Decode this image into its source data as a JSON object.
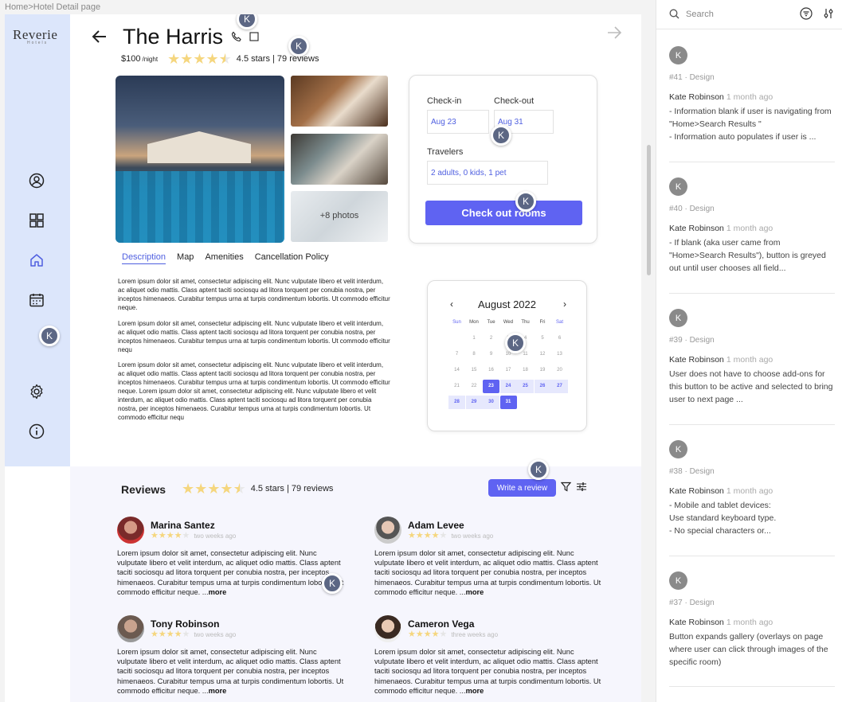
{
  "breadcrumb": "Home>Hotel Detail page",
  "brand": {
    "name": "Reverie",
    "sub": "Hotels"
  },
  "nav": {
    "items": [
      {
        "name": "profile",
        "icon": "user-circle-icon"
      },
      {
        "name": "dashboard",
        "icon": "grid-icon"
      },
      {
        "name": "home",
        "icon": "home-icon"
      },
      {
        "name": "calendar",
        "icon": "calendar-icon"
      },
      {
        "name": "settings",
        "icon": "gear-icon"
      },
      {
        "name": "info",
        "icon": "info-icon"
      }
    ],
    "active": "home"
  },
  "hotel": {
    "name": "The Harris",
    "price": "$100",
    "price_unit": "/night",
    "rating": 4.5,
    "rating_text": "4.5 stars | 79 reviews"
  },
  "gallery": {
    "more_label": "+8 photos"
  },
  "booking": {
    "checkin_label": "Check-in",
    "checkin_value": "Aug 23",
    "checkout_label": "Check-out",
    "checkout_value": "Aug 31",
    "travelers_label": "Travelers",
    "travelers_value": "2 adults, 0 kids, 1 pet",
    "button_label": "Check out rooms"
  },
  "tabs": [
    {
      "label": "Description",
      "active": true
    },
    {
      "label": "Map",
      "active": false
    },
    {
      "label": "Amenities",
      "active": false
    },
    {
      "label": "Cancellation Policy",
      "active": false
    }
  ],
  "description": [
    "Lorem ipsum dolor sit amet, consectetur adipiscing elit. Nunc vulputate libero et velit interdum, ac aliquet odio mattis. Class aptent taciti sociosqu ad litora torquent per conubia nostra, per inceptos himenaeos. Curabitur tempus urna at turpis condimentum lobortis. Ut commodo efficitur neque.",
    "Lorem ipsum dolor sit amet, consectetur adipiscing elit. Nunc vulputate libero et velit interdum, ac aliquet odio mattis. Class aptent taciti sociosqu ad litora torquent per conubia nostra, per inceptos himenaeos. Curabitur tempus urna at turpis condimentum lobortis. Ut commodo efficitur nequ",
    "Lorem ipsum dolor sit amet, consectetur adipiscing elit. Nunc vulputate libero et velit interdum, ac aliquet odio mattis. Class aptent taciti sociosqu ad litora torquent per conubia nostra, per inceptos himenaeos. Curabitur tempus urna at turpis condimentum lobortis. Ut commodo efficitur neque. Lorem ipsum dolor sit amet, consectetur adipiscing elit. Nunc vulputate libero et velit interdum, ac aliquet odio mattis. Class aptent taciti sociosqu ad litora torquent per conubia nostra, per inceptos himenaeos. Curabitur tempus urna at turpis condimentum lobortis. Ut commodo efficitur nequ"
  ],
  "calendar": {
    "title": "August 2022",
    "prev": "‹",
    "next": "›",
    "weekdays": [
      "Sun",
      "Mon",
      "Tue",
      "Wed",
      "Thu",
      "Fri",
      "Sat"
    ],
    "weeks": [
      [
        "",
        "1",
        "2",
        "3",
        "4",
        "5",
        "6"
      ],
      [
        "7",
        "8",
        "9",
        "10",
        "11",
        "12",
        "13"
      ],
      [
        "14",
        "15",
        "16",
        "17",
        "18",
        "19",
        "20"
      ],
      [
        "21",
        "22",
        "23",
        "24",
        "25",
        "26",
        "27"
      ],
      [
        "28",
        "29",
        "30",
        "31",
        "",
        "",
        ""
      ]
    ],
    "range_start": "23",
    "range_end": "31",
    "range_color": "#5f63f2",
    "range_fill": "#e6e8fd"
  },
  "reviews": {
    "title": "Reviews",
    "rating_text": "4.5 stars | 79 reviews",
    "write_label": "Write a review",
    "items": [
      {
        "name": "Marina Santez",
        "when": "two weeks ago",
        "body": "Lorem ipsum dolor sit amet, consectetur adipiscing elit. Nunc vulputate libero et velit interdum, ac aliquet odio mattis. Class aptent taciti sociosqu ad litora torquent per conubia nostra, per inceptos himenaeos. Curabitur tempus urna at turpis condimentum lobortis. Ut commodo efficitur neque. ...",
        "more": "more"
      },
      {
        "name": "Adam Levee",
        "when": "two weeks ago",
        "body": "Lorem ipsum dolor sit amet, consectetur adipiscing elit. Nunc vulputate libero et velit interdum, ac aliquet odio mattis. Class aptent taciti sociosqu ad litora torquent per conubia nostra, per inceptos himenaeos. Curabitur tempus urna at turpis condimentum lobortis. Ut commodo efficitur neque. ...",
        "more": "more"
      },
      {
        "name": "Tony Robinson",
        "when": "two weeks ago",
        "body": "Lorem ipsum dolor sit amet, consectetur adipiscing elit. Nunc vulputate libero et velit interdum, ac aliquet odio mattis. Class aptent taciti sociosqu ad litora torquent per conubia nostra, per inceptos himenaeos. Curabitur tempus urna at turpis condimentum lobortis. Ut commodo efficitur neque. ...",
        "more": "more"
      },
      {
        "name": "Cameron Vega",
        "when": "three weeks ago",
        "body": "Lorem ipsum dolor sit amet, consectetur adipiscing elit. Nunc vulputate libero et velit interdum, ac aliquet odio mattis. Class aptent taciti sociosqu ad litora torquent per conubia nostra, per inceptos himenaeos. Curabitur tempus urna at turpis condimentum lobortis. Ut commodo efficitur neque. ...",
        "more": "more"
      }
    ]
  },
  "collab_marker": "K",
  "sidebar": {
    "search_placeholder": "Search",
    "comments": [
      {
        "avatar": "K",
        "tag": "#41 · Design",
        "author": "Kate Robinson",
        "time": "1 month ago",
        "body": "- Information blank if user is navigating from \"Home>Search Results \"\n- Information auto populates if user is ..."
      },
      {
        "avatar": "K",
        "tag": "#40 · Design",
        "author": "Kate Robinson",
        "time": "1 month ago",
        "body": "- If blank (aka user came from \"Home>Search Results\"), button is greyed out until user chooses all field..."
      },
      {
        "avatar": "K",
        "tag": "#39 · Design",
        "author": "Kate Robinson",
        "time": "1 month ago",
        "body": "User does not have to choose add-ons for this button to be active and selected to bring user to next page ..."
      },
      {
        "avatar": "K",
        "tag": "#38 · Design",
        "author": "Kate Robinson",
        "time": "1 month ago",
        "body": "- Mobile and tablet devices:\nUse standard keyboard type.\n- No special characters or..."
      },
      {
        "avatar": "K",
        "tag": "#37 · Design",
        "author": "Kate Robinson",
        "time": "1 month ago",
        "body": "Button expands gallery (overlays on page where user can click through images of the specific room)"
      }
    ]
  }
}
